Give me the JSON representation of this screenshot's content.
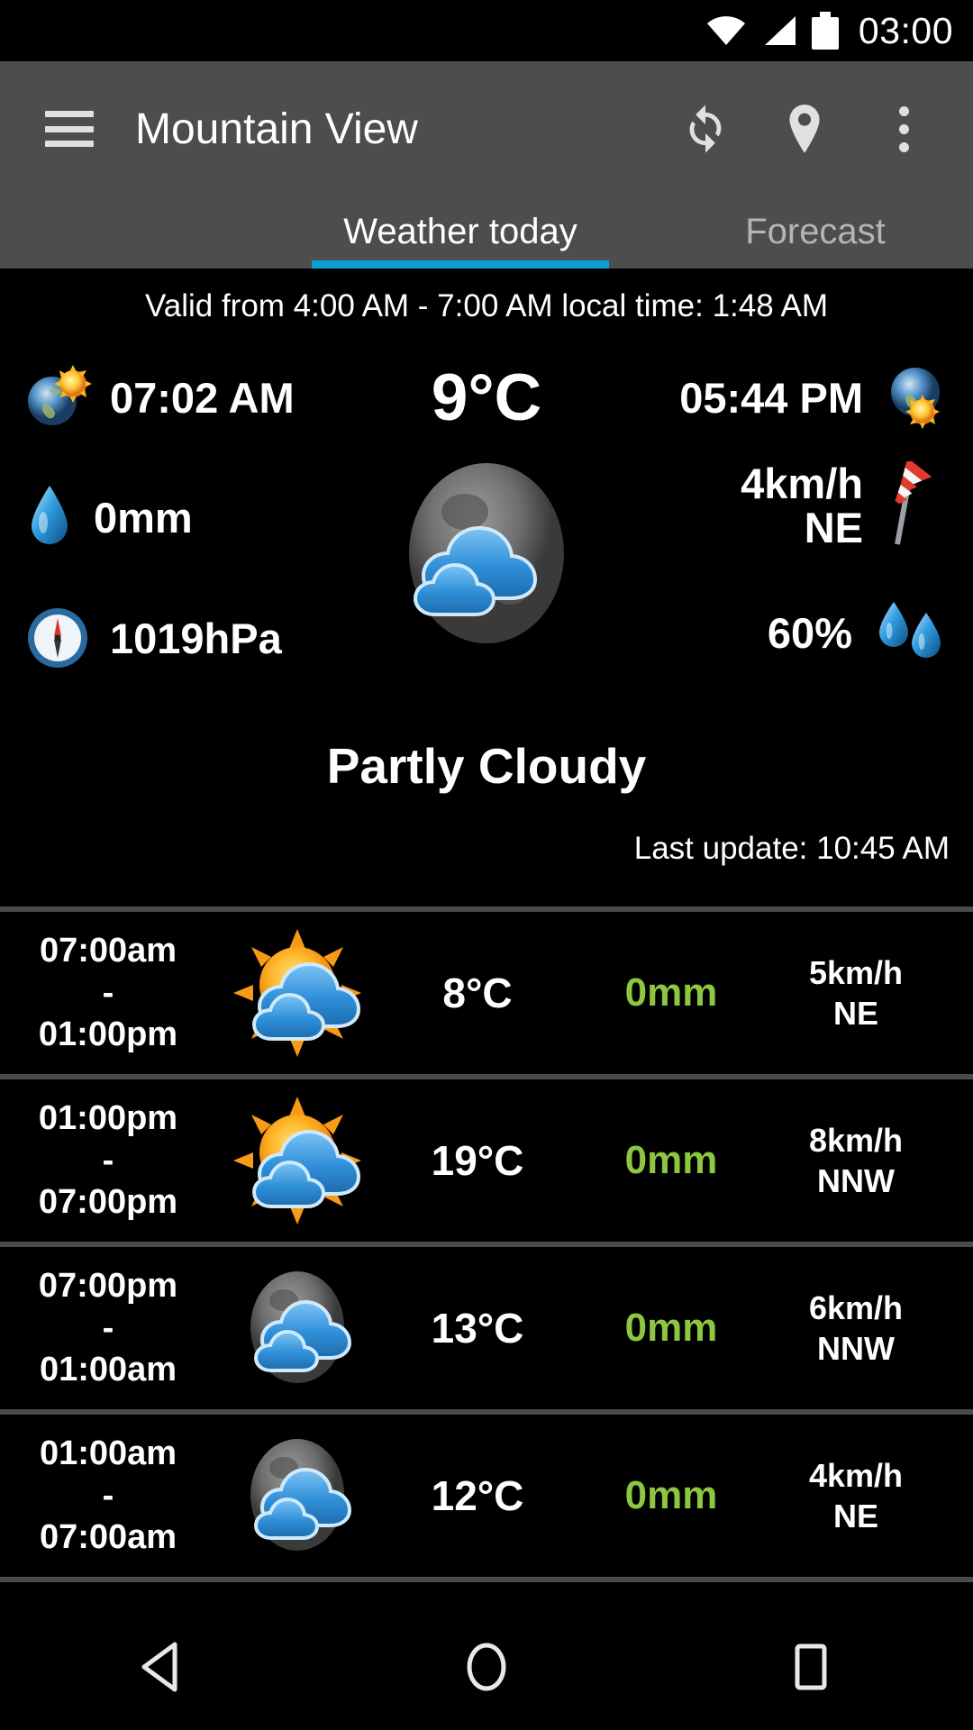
{
  "status_bar": {
    "clock": "03:00",
    "icons": [
      "wifi-icon",
      "cellular-signal-icon",
      "battery-icon"
    ]
  },
  "toolbar": {
    "menu_icon": "hamburger-menu-icon",
    "title": "Mountain View",
    "refresh_icon": "refresh-icon",
    "location_icon": "location-pin-icon",
    "overflow_icon": "overflow-menu-icon"
  },
  "tabs": {
    "active_index": 0,
    "items": [
      {
        "label": "Weather today"
      },
      {
        "label": "Forecast"
      }
    ],
    "indicator_color": "#0a9fd4"
  },
  "current": {
    "valid_line": "Valid from 4:00 AM - 7:00 AM local time: 1:48 AM",
    "sunrise": "07:02 AM",
    "sunset": "05:44 PM",
    "temperature": "9°C",
    "precipitation": "0mm",
    "pressure": "1019hPa",
    "wind_speed": "4km/h",
    "wind_direction": "NE",
    "humidity": "60%",
    "condition": "Partly Cloudy",
    "last_update": "Last update: 10:45 AM",
    "main_icon": "moon-cloudy-icon",
    "sunrise_icon": "sunrise-earth-icon",
    "sunset_icon": "sunset-earth-icon",
    "precip_icon": "water-drop-icon",
    "pressure_icon": "barometer-icon",
    "wind_icon": "windsock-icon",
    "humidity_icon": "humidity-drops-icon"
  },
  "forecast_rows": [
    {
      "time": "07:00am\n-\n01:00pm",
      "time_start": "07:00am",
      "time_sep": "-",
      "time_end": "01:00pm",
      "icon": "sun-cloudy-icon",
      "temp": "8°C",
      "precip": "0mm",
      "wind_speed": "5km/h",
      "wind_dir": "NE"
    },
    {
      "time": "01:00pm\n-\n07:00pm",
      "time_start": "01:00pm",
      "time_sep": "-",
      "time_end": "07:00pm",
      "icon": "sun-cloudy-icon",
      "temp": "19°C",
      "precip": "0mm",
      "wind_speed": "8km/h",
      "wind_dir": "NNW"
    },
    {
      "time": "07:00pm\n-\n01:00am",
      "time_start": "07:00pm",
      "time_sep": "-",
      "time_end": "01:00am",
      "icon": "moon-cloudy-icon",
      "temp": "13°C",
      "precip": "0mm",
      "wind_speed": "6km/h",
      "wind_dir": "NNW"
    },
    {
      "time": "01:00am\n-\n07:00am",
      "time_start": "01:00am",
      "time_sep": "-",
      "time_end": "07:00am",
      "icon": "moon-cloudy-icon",
      "temp": "12°C",
      "precip": "0mm",
      "wind_speed": "4km/h",
      "wind_dir": "NE"
    }
  ],
  "nav_bar": {
    "back_icon": "back-triangle-icon",
    "home_icon": "home-circle-icon",
    "recents_icon": "recents-square-icon"
  },
  "colors": {
    "toolbar_bg": "#4d4d4d",
    "accent": "#0a9fd4",
    "precip_green": "#8dc63f",
    "background": "#000000"
  }
}
